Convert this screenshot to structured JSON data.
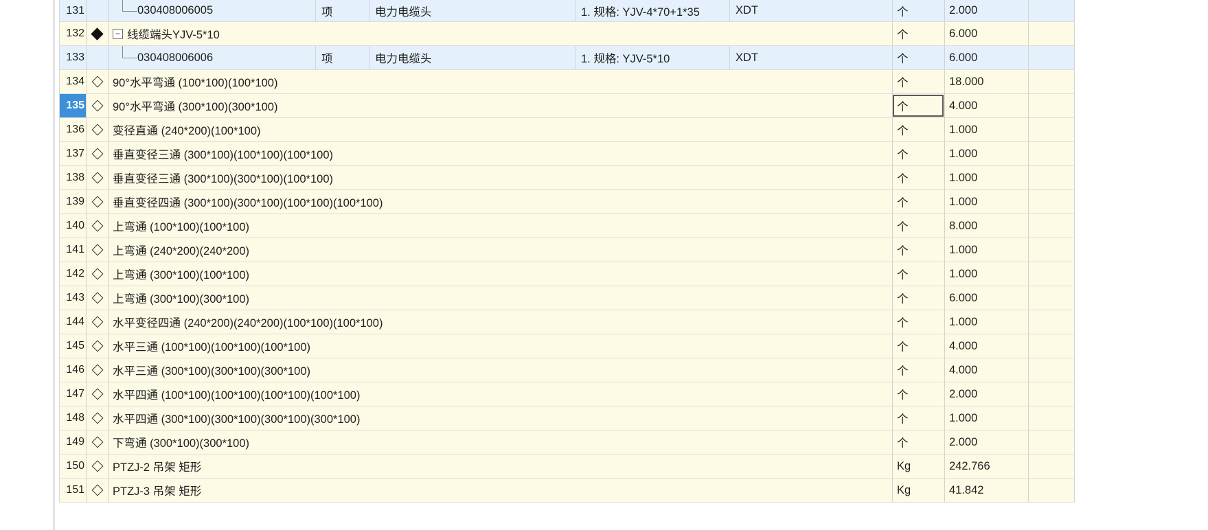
{
  "rows": [
    {
      "num": "131",
      "type": "child",
      "code": "030408006005",
      "unit_type": "项",
      "desc": "电力电缆头",
      "spec": "1. 规格: YJV-4*70+1*35",
      "brand": "XDT",
      "unit": "个",
      "qty": "2.000"
    },
    {
      "num": "132",
      "type": "group",
      "icon": "diamond-filled-icon",
      "expander": "−",
      "name": "线缆端头YJV-5*10",
      "unit": "个",
      "qty": "6.000"
    },
    {
      "num": "133",
      "type": "child",
      "code": "030408006006",
      "unit_type": "项",
      "desc": "电力电缆头",
      "spec": "1. 规格: YJV-5*10",
      "brand": "XDT",
      "unit": "个",
      "qty": "6.000"
    },
    {
      "num": "134",
      "type": "item",
      "icon": "diamond-outline-icon",
      "name": "90°水平弯通 (100*100)(100*100)",
      "unit": "个",
      "qty": "18.000"
    },
    {
      "num": "135",
      "type": "item",
      "icon": "diamond-outline-icon",
      "name": "90°水平弯通 (300*100)(300*100)",
      "unit": "个",
      "qty": "4.000",
      "selected": true
    },
    {
      "num": "136",
      "type": "item",
      "icon": "diamond-outline-icon",
      "name": "变径直通 (240*200)(100*100)",
      "unit": "个",
      "qty": "1.000"
    },
    {
      "num": "137",
      "type": "item",
      "icon": "diamond-outline-icon",
      "name": "垂直变径三通 (300*100)(100*100)(100*100)",
      "unit": "个",
      "qty": "1.000"
    },
    {
      "num": "138",
      "type": "item",
      "icon": "diamond-outline-icon",
      "name": "垂直变径三通 (300*100)(300*100)(100*100)",
      "unit": "个",
      "qty": "1.000"
    },
    {
      "num": "139",
      "type": "item",
      "icon": "diamond-outline-icon",
      "name": "垂直变径四通 (300*100)(300*100)(100*100)(100*100)",
      "unit": "个",
      "qty": "1.000"
    },
    {
      "num": "140",
      "type": "item",
      "icon": "diamond-outline-icon",
      "name": "上弯通 (100*100)(100*100)",
      "unit": "个",
      "qty": "8.000"
    },
    {
      "num": "141",
      "type": "item",
      "icon": "diamond-outline-icon",
      "name": "上弯通 (240*200)(240*200)",
      "unit": "个",
      "qty": "1.000"
    },
    {
      "num": "142",
      "type": "item",
      "icon": "diamond-outline-icon",
      "name": "上弯通 (300*100)(100*100)",
      "unit": "个",
      "qty": "1.000"
    },
    {
      "num": "143",
      "type": "item",
      "icon": "diamond-outline-icon",
      "name": "上弯通 (300*100)(300*100)",
      "unit": "个",
      "qty": "6.000"
    },
    {
      "num": "144",
      "type": "item",
      "icon": "diamond-outline-icon",
      "name": "水平变径四通 (240*200)(240*200)(100*100)(100*100)",
      "unit": "个",
      "qty": "1.000"
    },
    {
      "num": "145",
      "type": "item",
      "icon": "diamond-outline-icon",
      "name": "水平三通 (100*100)(100*100)(100*100)",
      "unit": "个",
      "qty": "4.000"
    },
    {
      "num": "146",
      "type": "item",
      "icon": "diamond-outline-icon",
      "name": "水平三通 (300*100)(300*100)(300*100)",
      "unit": "个",
      "qty": "4.000"
    },
    {
      "num": "147",
      "type": "item",
      "icon": "diamond-outline-icon",
      "name": "水平四通 (100*100)(100*100)(100*100)(100*100)",
      "unit": "个",
      "qty": "2.000"
    },
    {
      "num": "148",
      "type": "item",
      "icon": "diamond-outline-icon",
      "name": "水平四通 (300*100)(300*100)(300*100)(300*100)",
      "unit": "个",
      "qty": "1.000"
    },
    {
      "num": "149",
      "type": "item",
      "icon": "diamond-outline-icon",
      "name": "下弯通 (300*100)(300*100)",
      "unit": "个",
      "qty": "2.000"
    },
    {
      "num": "150",
      "type": "item",
      "icon": "diamond-outline-icon",
      "name": "PTZJ-2 吊架 矩形",
      "unit": "Kg",
      "qty": "242.766"
    },
    {
      "num": "151",
      "type": "item",
      "icon": "diamond-outline-icon",
      "name": "PTZJ-3 吊架 矩形",
      "unit": "Kg",
      "qty": "41.842"
    }
  ],
  "colors": {
    "row_background": "#fdfbe6",
    "child_row_background": "#e4f1fc",
    "selected_row_number": "#3c8fd8",
    "change_marker": "#74c365"
  }
}
